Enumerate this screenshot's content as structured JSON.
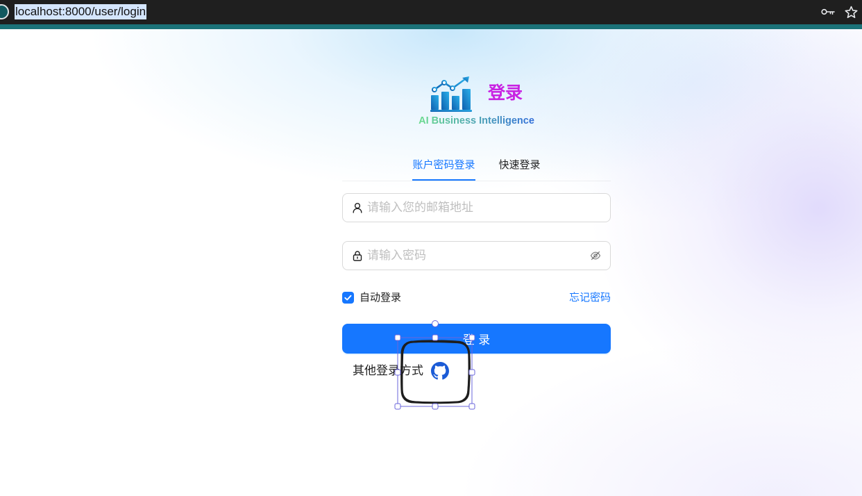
{
  "browser": {
    "url": "localhost:8000/user/login",
    "url_selected": true,
    "site_info_icon": "site-info-icon",
    "password_key_icon": "key-icon",
    "bookmark_icon": "star-icon"
  },
  "brand": {
    "logo_icon": "bar-chart-logo-icon",
    "title": "登录",
    "subtitle": "AI Business Intelligence"
  },
  "tabs": [
    {
      "label": "账户密码登录",
      "active": true
    },
    {
      "label": "快速登录",
      "active": false
    }
  ],
  "form": {
    "email": {
      "icon": "user-icon",
      "value": "",
      "placeholder": "请输入您的邮箱地址"
    },
    "password": {
      "icon": "lock-icon",
      "value": "",
      "placeholder": "请输入密码",
      "visibility_icon": "eye-invisible-icon"
    },
    "auto_login": {
      "label": "自动登录",
      "checked": true,
      "icon": "checkbox-checked-icon"
    },
    "forgot_password": "忘记密码",
    "submit_label": "登 录"
  },
  "other_login": {
    "label": "其他登录方式",
    "providers": [
      {
        "icon": "github-icon"
      }
    ]
  },
  "annotation": {
    "shape_selected": true
  },
  "theme": {
    "primary": "#1677ff",
    "title": "#c822e2",
    "subtitle_start": "#6bdb8d",
    "subtitle_end": "#2f6cd9",
    "logo_start": "#0f5fae",
    "logo_end": "#2bb0ea",
    "github": "#1b5bd6",
    "browser_bar": "#1f1f1f",
    "browser_accent": "#1b7278",
    "annotation_stroke": "#1e1e1e",
    "selection": "#6965db"
  }
}
